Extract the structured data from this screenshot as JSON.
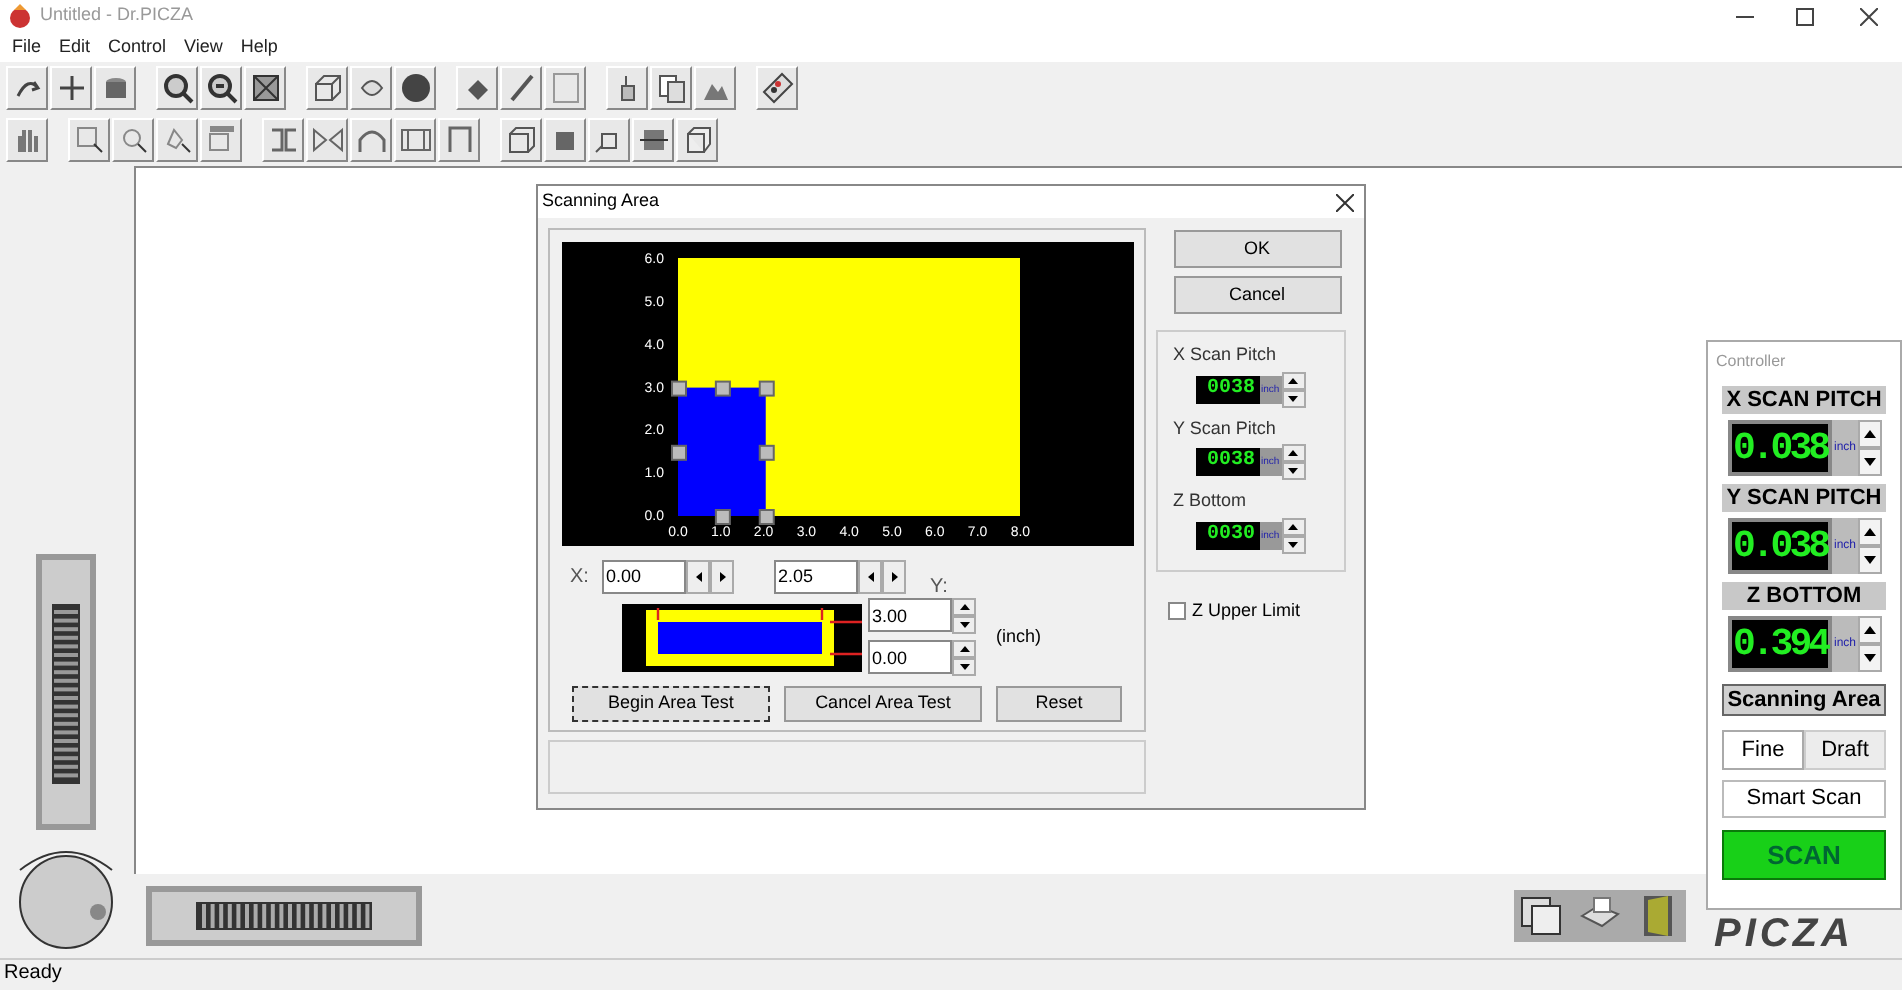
{
  "window": {
    "title": "Untitled - Dr.PICZA"
  },
  "menu": [
    "File",
    "Edit",
    "Control",
    "View",
    "Help"
  ],
  "dialog": {
    "title": "Scanning Area",
    "plot": {
      "x_ticks": [
        "0.0",
        "1.0",
        "2.0",
        "3.0",
        "4.0",
        "5.0",
        "6.0",
        "7.0",
        "8.0"
      ],
      "y_ticks": [
        "6.0",
        "5.0",
        "4.0",
        "3.0",
        "2.0",
        "1.0",
        "0.0"
      ]
    },
    "buttons": [
      "OK",
      "Cancel"
    ],
    "pitch_fields": [
      {
        "label": "X Scan Pitch",
        "value": "0038",
        "unit": "inch"
      },
      {
        "label": "Y Scan Pitch",
        "value": "0038",
        "unit": "inch"
      },
      {
        "label": "Z Bottom",
        "value": "0030",
        "unit": "inch"
      }
    ],
    "z_upper_limit": {
      "label": "Z Upper Limit",
      "checked": false
    },
    "x_label": "X:",
    "x_from": "0.00",
    "x_to": "2.05",
    "y_label": "Y:",
    "y_to": "3.00",
    "y_from": "0.00",
    "unit": "(inch)",
    "test_buttons": [
      {
        "label": "Begin Area Test",
        "focused": true
      },
      {
        "label": "Cancel Area Test",
        "focused": false
      },
      {
        "label": "Reset",
        "focused": false
      }
    ]
  },
  "controller": {
    "title": "Controller",
    "readouts": [
      {
        "label": "X SCAN PITCH",
        "value": "0.038",
        "unit": "inch"
      },
      {
        "label": "Y SCAN PITCH",
        "value": "0.038",
        "unit": "inch"
      },
      {
        "label": "Z BOTTOM",
        "value": "0.394",
        "unit": "inch"
      }
    ],
    "area_button": "Scanning Area",
    "modes": [
      {
        "label": "Fine",
        "selected": true
      },
      {
        "label": "Draft",
        "selected": false
      }
    ],
    "smart_scan": "Smart Scan",
    "scan": "SCAN"
  },
  "logo": "PICZA",
  "status_bar": "Ready"
}
